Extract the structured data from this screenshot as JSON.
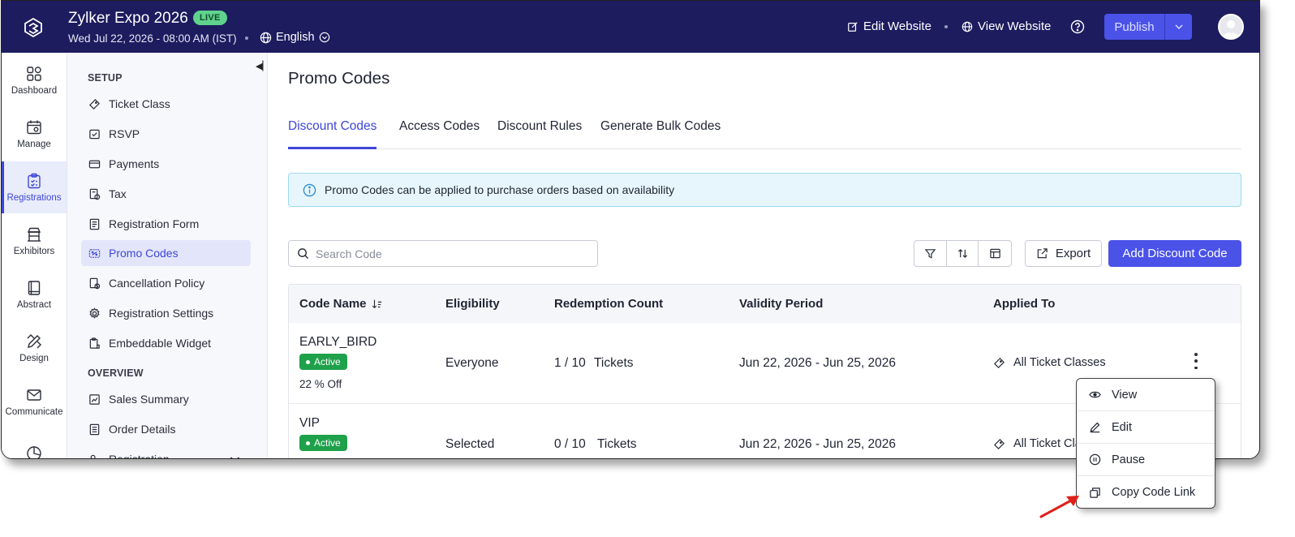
{
  "header": {
    "event_title": "Zylker Expo 2026",
    "live_badge": "LIVE",
    "event_date": "Wed Jul 22, 2026 - 08:00 AM (IST)",
    "language": "English",
    "edit_website": "Edit Website",
    "view_website": "View Website",
    "publish": "Publish",
    "brand_color": "#1d1c5f",
    "accent_color": "#4a52e8"
  },
  "rail": {
    "items": [
      {
        "label": "Dashboard",
        "icon": "grid-icon"
      },
      {
        "label": "Manage",
        "icon": "calendar-gear-icon"
      },
      {
        "label": "Registrations",
        "icon": "clipboard-icon"
      },
      {
        "label": "Exhibitors",
        "icon": "booth-icon"
      },
      {
        "label": "Abstract",
        "icon": "book-icon"
      },
      {
        "label": "Design",
        "icon": "pen-ruler-icon"
      },
      {
        "label": "Communicate",
        "icon": "mail-icon"
      },
      {
        "label": "",
        "icon": "pie-chart-icon"
      }
    ]
  },
  "subnav": {
    "setup_label": "SETUP",
    "overview_label": "OVERVIEW",
    "setup_items": [
      {
        "label": "Ticket Class",
        "icon": "ticket-icon"
      },
      {
        "label": "RSVP",
        "icon": "rsvp-icon"
      },
      {
        "label": "Payments",
        "icon": "card-icon"
      },
      {
        "label": "Tax",
        "icon": "tax-icon"
      },
      {
        "label": "Registration Form",
        "icon": "form-icon"
      },
      {
        "label": "Promo Codes",
        "icon": "promo-icon"
      },
      {
        "label": "Cancellation Policy",
        "icon": "cancel-doc-icon"
      },
      {
        "label": "Registration Settings",
        "icon": "gear-icon"
      },
      {
        "label": "Embeddable Widget",
        "icon": "widget-icon"
      }
    ],
    "overview_items": [
      {
        "label": "Sales Summary",
        "icon": "chart-icon"
      },
      {
        "label": "Order Details",
        "icon": "order-icon"
      },
      {
        "label": "Registration",
        "icon": "registration-icon"
      }
    ]
  },
  "main": {
    "page_title": "Promo Codes",
    "tabs": [
      "Discount Codes",
      "Access Codes",
      "Discount Rules",
      "Generate Bulk Codes"
    ],
    "info_banner": "Promo Codes can be applied to purchase orders based on availability",
    "search_placeholder": "Search Code",
    "export_label": "Export",
    "add_label": "Add Discount Code"
  },
  "table": {
    "columns": [
      "Code Name",
      "Eligibility",
      "Redemption Count",
      "Validity Period",
      "Applied To"
    ],
    "rows": [
      {
        "code": "EARLY_BIRD",
        "status": "Active",
        "discount": "22 % Off",
        "eligibility": "Everyone",
        "redemption": "1 / 10",
        "unit": "Tickets",
        "validity": "Jun 22, 2026 - Jun 25, 2026",
        "applied_to": "All Ticket Classes"
      },
      {
        "code": "VIP",
        "status": "Active",
        "discount": "",
        "eligibility": "Selected",
        "redemption": "0 / 10",
        "unit": "Tickets",
        "validity": "Jun 22, 2026 - Jun 25, 2026",
        "applied_to": "All Ticket Cla"
      }
    ]
  },
  "menu": {
    "items": [
      {
        "label": "View",
        "icon": "eye-icon"
      },
      {
        "label": "Edit",
        "icon": "pencil-icon"
      },
      {
        "label": "Pause",
        "icon": "pause-icon"
      },
      {
        "label": "Copy Code Link",
        "icon": "copy-icon"
      }
    ]
  }
}
